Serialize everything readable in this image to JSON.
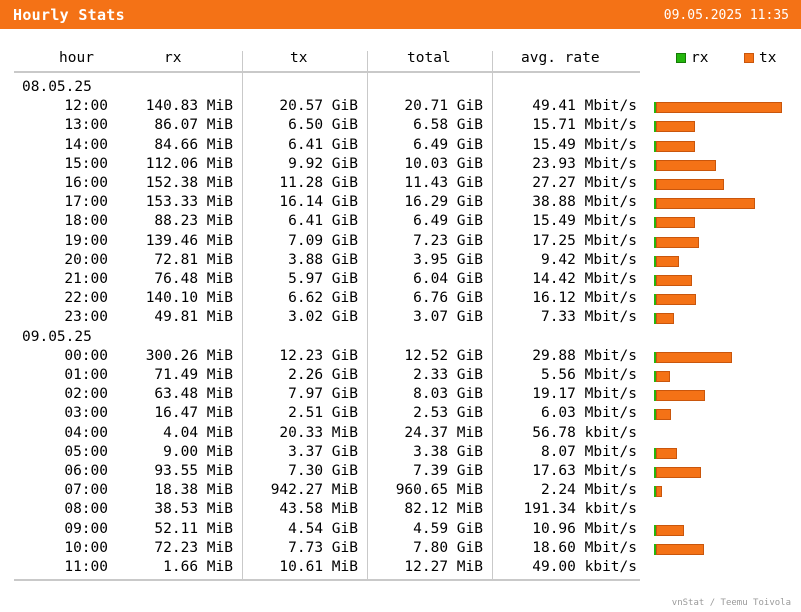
{
  "header": {
    "title": "Hourly Stats",
    "datetime": "09.05.2025 11:35"
  },
  "columns": {
    "hour": "hour",
    "rx": "rx",
    "tx": "tx",
    "total": "total",
    "rate": "avg. rate"
  },
  "legend": {
    "rx_label": "rx",
    "tx_label": "tx",
    "rx_color": "#24b60d",
    "tx_color": "#f47216"
  },
  "groups": [
    {
      "date": "08.05.25",
      "rows": [
        {
          "hour": "12:00",
          "rx": "140.83 MiB",
          "tx": "20.57 GiB",
          "total": "20.71 GiB",
          "rate": "49.41 Mbit/s",
          "bar_rx": 0.017,
          "bar_tx": 0.983
        },
        {
          "hour": "13:00",
          "rx": "86.07 MiB",
          "tx": "6.50 GiB",
          "total": "6.58 GiB",
          "rate": "15.71 Mbit/s",
          "bar_rx": 0.01,
          "bar_tx": 0.308
        },
        {
          "hour": "14:00",
          "rx": "84.66 MiB",
          "tx": "6.41 GiB",
          "total": "6.49 GiB",
          "rate": "15.49 Mbit/s",
          "bar_rx": 0.01,
          "bar_tx": 0.304
        },
        {
          "hour": "15:00",
          "rx": "112.06 MiB",
          "tx": "9.92 GiB",
          "total": "10.03 GiB",
          "rate": "23.93 Mbit/s",
          "bar_rx": 0.013,
          "bar_tx": 0.472
        },
        {
          "hour": "16:00",
          "rx": "152.38 MiB",
          "tx": "11.28 GiB",
          "total": "11.43 GiB",
          "rate": "27.27 Mbit/s",
          "bar_rx": 0.017,
          "bar_tx": 0.535
        },
        {
          "hour": "17:00",
          "rx": "153.33 MiB",
          "tx": "16.14 GiB",
          "total": "16.29 GiB",
          "rate": "38.88 Mbit/s",
          "bar_rx": 0.017,
          "bar_tx": 0.77
        },
        {
          "hour": "18:00",
          "rx": "88.23 MiB",
          "tx": "6.41 GiB",
          "total": "6.49 GiB",
          "rate": "15.49 Mbit/s",
          "bar_rx": 0.01,
          "bar_tx": 0.304
        },
        {
          "hour": "19:00",
          "rx": "139.46 MiB",
          "tx": "7.09 GiB",
          "total": "7.23 GiB",
          "rate": "17.25 Mbit/s",
          "bar_rx": 0.016,
          "bar_tx": 0.335
        },
        {
          "hour": "20:00",
          "rx": "72.81 MiB",
          "tx": "3.88 GiB",
          "total": "3.95 GiB",
          "rate": "9.42 Mbit/s",
          "bar_rx": 0.008,
          "bar_tx": 0.183
        },
        {
          "hour": "21:00",
          "rx": "76.48 MiB",
          "tx": "5.97 GiB",
          "total": "6.04 GiB",
          "rate": "14.42 Mbit/s",
          "bar_rx": 0.009,
          "bar_tx": 0.283
        },
        {
          "hour": "22:00",
          "rx": "140.10 MiB",
          "tx": "6.62 GiB",
          "total": "6.76 GiB",
          "rate": "16.12 Mbit/s",
          "bar_rx": 0.016,
          "bar_tx": 0.313
        },
        {
          "hour": "23:00",
          "rx": "49.81 MiB",
          "tx": "3.02 GiB",
          "total": "3.07 GiB",
          "rate": "7.33 Mbit/s",
          "bar_rx": 0.006,
          "bar_tx": 0.143
        }
      ]
    },
    {
      "date": "09.05.25",
      "rows": [
        {
          "hour": "00:00",
          "rx": "300.26 MiB",
          "tx": "12.23 GiB",
          "total": "12.52 GiB",
          "rate": "29.88 Mbit/s",
          "bar_rx": 0.014,
          "bar_tx": 0.591
        },
        {
          "hour": "01:00",
          "rx": "71.49 MiB",
          "tx": "2.26 GiB",
          "total": "2.33 GiB",
          "rate": "5.56 Mbit/s",
          "bar_rx": 0.003,
          "bar_tx": 0.11
        },
        {
          "hour": "02:00",
          "rx": "63.48 MiB",
          "tx": "7.97 GiB",
          "total": "8.03 GiB",
          "rate": "19.17 Mbit/s",
          "bar_rx": 0.004,
          "bar_tx": 0.384
        },
        {
          "hour": "03:00",
          "rx": "16.47 MiB",
          "tx": "2.51 GiB",
          "total": "2.53 GiB",
          "rate": "6.03 Mbit/s",
          "bar_rx": 0.001,
          "bar_tx": 0.121
        },
        {
          "hour": "04:00",
          "rx": "4.04 MiB",
          "tx": "20.33 MiB",
          "total": "24.37 MiB",
          "rate": "56.78 kbit/s",
          "bar_rx": 0.0,
          "bar_tx": 0.0
        },
        {
          "hour": "05:00",
          "rx": "9.00 MiB",
          "tx": "3.37 GiB",
          "total": "3.38 GiB",
          "rate": "8.07 Mbit/s",
          "bar_rx": 0.001,
          "bar_tx": 0.162
        },
        {
          "hour": "06:00",
          "rx": "93.55 MiB",
          "tx": "7.30 GiB",
          "total": "7.39 GiB",
          "rate": "17.63 Mbit/s",
          "bar_rx": 0.004,
          "bar_tx": 0.349
        },
        {
          "hour": "07:00",
          "rx": "18.38 MiB",
          "tx": "942.27 MiB",
          "total": "960.65 MiB",
          "rate": "2.24 Mbit/s",
          "bar_rx": 0.001,
          "bar_tx": 0.045
        },
        {
          "hour": "08:00",
          "rx": "38.53 MiB",
          "tx": "43.58 MiB",
          "total": "82.12 MiB",
          "rate": "191.34 kbit/s",
          "bar_rx": 0.0,
          "bar_tx": 0.0
        },
        {
          "hour": "09:00",
          "rx": "52.11 MiB",
          "tx": "4.54 GiB",
          "total": "4.59 GiB",
          "rate": "10.96 Mbit/s",
          "bar_rx": 0.002,
          "bar_tx": 0.216
        },
        {
          "hour": "10:00",
          "rx": "72.23 MiB",
          "tx": "7.73 GiB",
          "total": "7.80 GiB",
          "rate": "18.60 Mbit/s",
          "bar_rx": 0.003,
          "bar_tx": 0.372
        },
        {
          "hour": "11:00",
          "rx": "1.66 MiB",
          "tx": "10.61 MiB",
          "total": "12.27 MiB",
          "rate": "49.00 kbit/s",
          "bar_rx": 0.0,
          "bar_tx": 0.0
        }
      ]
    }
  ],
  "footer": {
    "credit": "vnStat / Teemu Toivola"
  }
}
